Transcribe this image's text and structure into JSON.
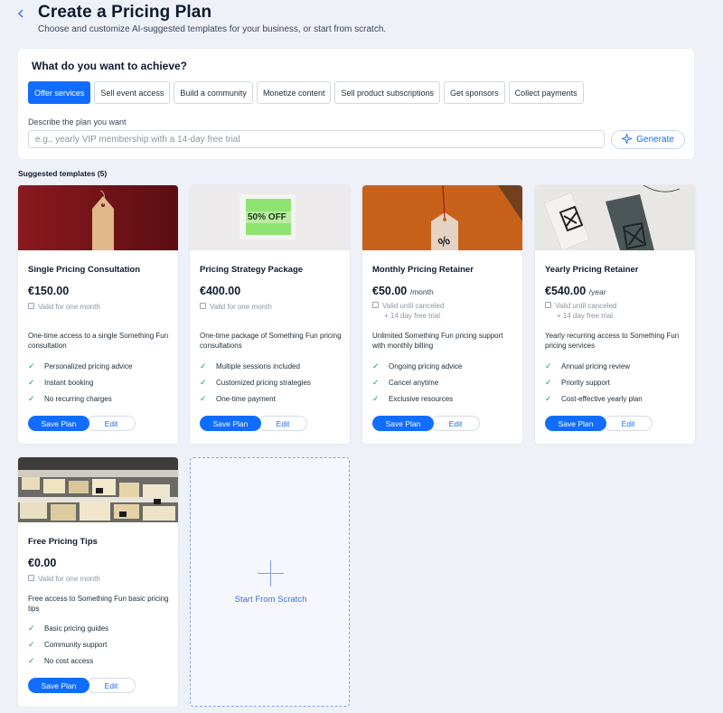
{
  "header": {
    "back_icon": "chevron-left-icon",
    "title": "Create a Pricing Plan",
    "subtitle": "Choose and customize AI-suggested templates for your business, or start from scratch."
  },
  "goal_panel": {
    "title": "What do you want to achieve?",
    "chips": [
      {
        "label": "Offer services",
        "selected": true
      },
      {
        "label": "Sell event access",
        "selected": false
      },
      {
        "label": "Build a community",
        "selected": false
      },
      {
        "label": "Monetize content",
        "selected": false
      },
      {
        "label": "Sell product subscriptions",
        "selected": false
      },
      {
        "label": "Get sponsors",
        "selected": false
      },
      {
        "label": "Collect payments",
        "selected": false
      }
    ],
    "describe_label": "Describe the plan you want",
    "describe_value": "",
    "describe_placeholder": "e.g., yearly VIP membership with a 14-day free trial",
    "generate_label": "Generate",
    "generate_icon": "sparkle-icon"
  },
  "templates": {
    "section_label": "Suggested templates (5)",
    "cards": [
      {
        "name": "Single Pricing Consultation",
        "price": "€150.00",
        "period": "",
        "validity": [
          "Valid for one month"
        ],
        "description": "One-time access to a single Something Fun consultation",
        "features": [
          "Personalized pricing advice",
          "Instant booking",
          "No recurring charges"
        ],
        "save_label": "Save Plan",
        "edit_label": "Edit"
      },
      {
        "name": "Pricing Strategy Package",
        "price": "€400.00",
        "period": "",
        "validity": [
          "Valid for one month"
        ],
        "description": "One-time package of Something Fun pricing consultations",
        "features": [
          "Multiple sessions included",
          "Customized pricing strategies",
          "One-time payment"
        ],
        "save_label": "Save Plan",
        "edit_label": "Edit",
        "image_text": "50% OFF"
      },
      {
        "name": "Monthly Pricing Retainer",
        "price": "€50.00",
        "period": "/month",
        "validity": [
          "Valid until canceled",
          "+ 14 day free trial"
        ],
        "description": "Unlimited Something Fun pricing support with monthly billing",
        "features": [
          "Ongoing pricing advice",
          "Cancel anytime",
          "Exclusive resources"
        ],
        "save_label": "Save Plan",
        "edit_label": "Edit"
      },
      {
        "name": "Yearly Pricing Retainer",
        "price": "€540.00",
        "period": "/year",
        "validity": [
          "Valid until canceled",
          "+ 14 day free trial"
        ],
        "description": "Yearly recurring access to Something Fun pricing services",
        "features": [
          "Annual pricing review",
          "Priority support",
          "Cost-effective yearly plan"
        ],
        "save_label": "Save Plan",
        "edit_label": "Edit"
      },
      {
        "name": "Free Pricing Tips",
        "price": "€0.00",
        "period": "",
        "validity": [
          "Valid for one month"
        ],
        "description": "Free access to Something Fun basic pricing tips",
        "features": [
          "Basic pricing guides",
          "Community support",
          "No cost access"
        ],
        "save_label": "Save Plan",
        "edit_label": "Edit"
      }
    ],
    "start_from_scratch": "Start From Scratch"
  },
  "colors": {
    "accent": "#116dff",
    "check": "#1b9e4b",
    "background": "#eef1f7"
  }
}
